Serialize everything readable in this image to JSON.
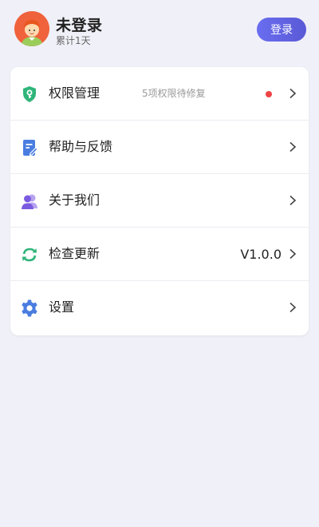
{
  "user": {
    "name": "未登录",
    "days": "累计1天",
    "login_label": "登录"
  },
  "menu": [
    {
      "label": "权限管理",
      "sub": "5项权限待修复",
      "has_dot": true,
      "icon": "shield-key-icon"
    },
    {
      "label": "帮助与反馈",
      "icon": "feedback-doc-icon"
    },
    {
      "label": "关于我们",
      "icon": "people-icon"
    },
    {
      "label": "检查更新",
      "value": "V1.0.0",
      "icon": "refresh-icon"
    },
    {
      "label": "设置",
      "icon": "gear-icon"
    }
  ],
  "colors": {
    "background": "#f0f0f8",
    "accent": "#5a5ad6",
    "dot": "#ee4444",
    "shield": "#2fb57a",
    "doc": "#4a7de0",
    "people": "#7b5be0",
    "refresh": "#2fb57a",
    "gear": "#4a7de0"
  }
}
